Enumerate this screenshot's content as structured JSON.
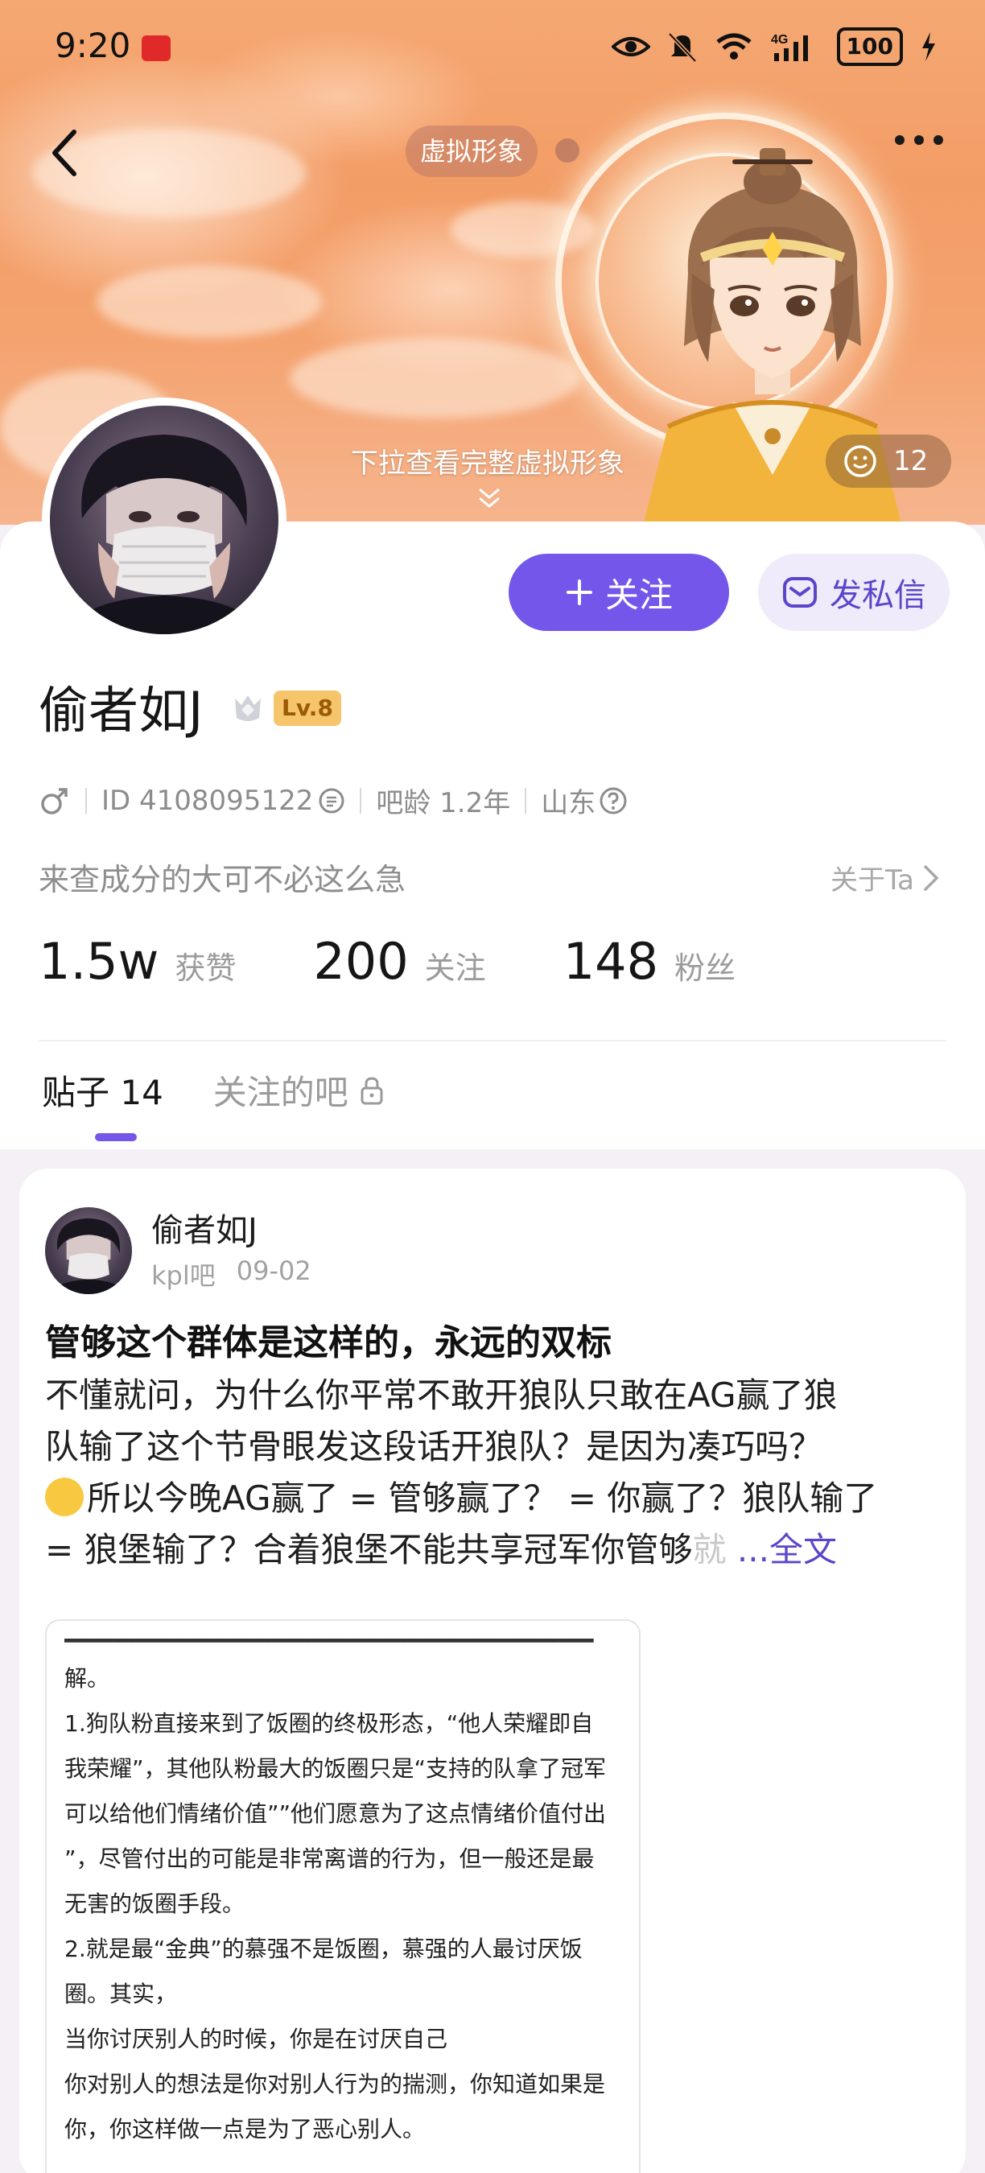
{
  "status_bar": {
    "time": "9:20",
    "battery": "100"
  },
  "hero": {
    "virtual_tag": "虚拟形象",
    "pull_hint": "下拉查看完整虚拟形象",
    "like_count": "12"
  },
  "profile": {
    "follow_label": "关注",
    "message_label": "发私信",
    "username": "偷者如J",
    "level": "Lv.8",
    "id_text": "ID 4108095122",
    "age_text": "吧龄 1.2年",
    "location": "山东",
    "bio": "来查成分的大可不必这么急",
    "about_label": "关于Ta",
    "stats": [
      {
        "num": "1.5w",
        "label": "获赞"
      },
      {
        "num": "200",
        "label": "关注"
      },
      {
        "num": "148",
        "label": "粉丝"
      }
    ],
    "tabs": [
      {
        "label": "贴子 14"
      },
      {
        "label": "关注的吧"
      }
    ]
  },
  "post": {
    "author": "偷者如J",
    "forum": "kpl吧",
    "date": "09-02",
    "title": "管够这个群体是这样的，永远的双标",
    "body_line1": "不懂就问，为什么你平常不敢开狼队只敢在AG赢了狼",
    "body_line2": "队输了这个节骨眼发这段话开狼队？是因为凑巧吗？",
    "body_line3": "所以今晚AG赢了 = 管够赢了？ = 你赢了？狼队输了",
    "body_line4": "= 狼堡输了？合着狼堡不能共享冠军你管够",
    "body_fade": "就",
    "more_label": "...全文",
    "image_lines": [
      "解。",
      "1.狗队粉直接来到了饭圈的终极形态，“他人荣耀即自",
      "我荣耀”，其他队粉最大的饭圈只是“支持的队拿了冠军",
      "可以给他们情绪价值””他们愿意为了这点情绪价值付出",
      "”，尽管付出的可能是非常离谱的行为，但一般还是最",
      "无害的饭圈手段。",
      "2.就是最“金典”的慕强不是饭圈，慕强的人最讨厌饭",
      "圈。其实，",
      "当你讨厌别人的时候，你是在讨厌自己",
      "你对别人的想法是你对别人行为的揣测，你知道如果是",
      "你，你这样做一点是为了恶心别人。"
    ]
  },
  "colors": {
    "accent": "#7457ea",
    "accent_soft": "#efebfb",
    "hero_orange": "#f0925a"
  }
}
